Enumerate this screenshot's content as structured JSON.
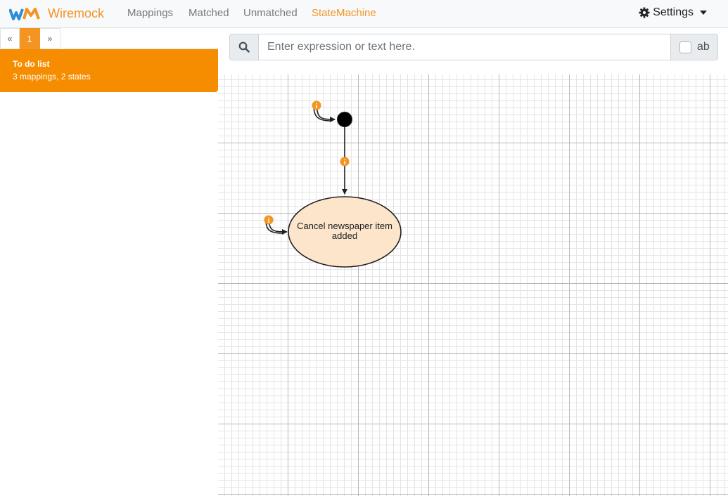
{
  "navbar": {
    "brand": "Wiremock",
    "links": [
      "Mappings",
      "Matched",
      "Unmatched",
      "StateMachine"
    ],
    "settings": "Settings"
  },
  "sidebar": {
    "pager": {
      "prev": "«",
      "current": "1",
      "next": "»"
    },
    "scenario": {
      "name": "To do list",
      "summary": "3 mappings, 2 states"
    }
  },
  "search": {
    "placeholder": "Enter expression or text here.",
    "case_label": "ab",
    "case_checked": false
  },
  "diagram": {
    "state_label": "Cancel newspaper item added"
  },
  "colors": {
    "accent": "#f39423",
    "scenario_bg": "#f68d00",
    "state_fill": "#fde5cc"
  }
}
